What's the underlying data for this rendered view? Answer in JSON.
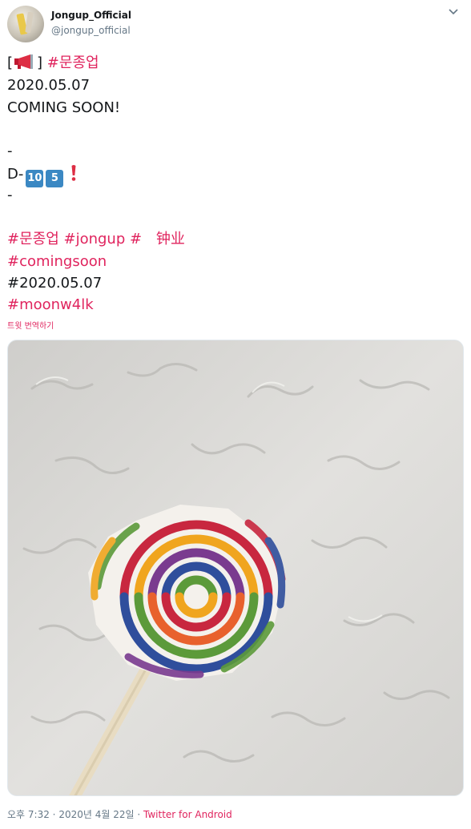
{
  "user": {
    "display_name": "Jongup_Official",
    "handle": "@jongup_official"
  },
  "tweet": {
    "line1_open": "[",
    "line1_close": "]",
    "line1_hashtag": "#문종업",
    "line2": "2020.05.07",
    "line3": "COMING SOON!",
    "line4": "-",
    "line5_prefix": "D-",
    "keycap_1": "10",
    "keycap_2": "5",
    "line6": "-",
    "tags_row1": [
      "#문종업",
      "#jongup",
      "#"
    ],
    "cjk_text": "钟业",
    "tag_row2": "#comingsoon",
    "plain_row3": "#2020.05.07",
    "tag_row4": "#moonw4lk",
    "translate_label": "트윗 번역하기"
  },
  "footer": {
    "time": "오후 7:32",
    "sep1": "·",
    "date": "2020년 4월 22일",
    "sep2": "·",
    "source": "Twitter for Android"
  },
  "colors": {
    "accent": "#e0245e",
    "text": "#14171a",
    "muted": "#657786",
    "keycap": "#3b88c3"
  },
  "icons": [
    "megaphone-icon",
    "keycap-10-icon",
    "keycap-5-icon",
    "red-exclamation-icon",
    "chevron-down-icon"
  ]
}
